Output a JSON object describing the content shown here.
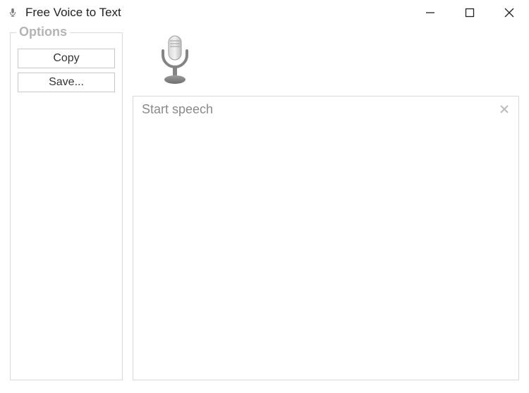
{
  "titlebar": {
    "title": "Free Voice to Text",
    "icon_name": "microphone-icon"
  },
  "options": {
    "legend": "Options",
    "copy_label": "Copy",
    "save_label": "Save..."
  },
  "main": {
    "placeholder": "Start speech"
  }
}
